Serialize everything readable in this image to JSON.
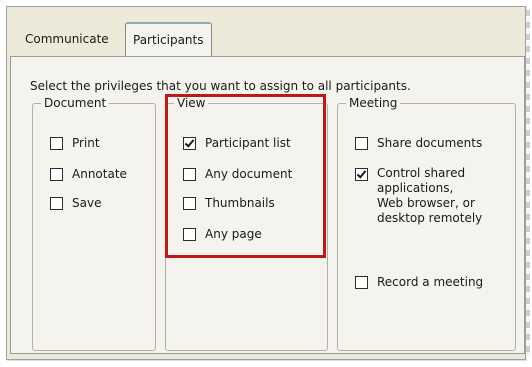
{
  "tabs": [
    {
      "label": "Communicate",
      "active": false
    },
    {
      "label": "Participants",
      "active": true
    }
  ],
  "instruction": "Select the privileges that you want to assign to all participants.",
  "groups": {
    "document": {
      "legend": "Document",
      "items": [
        {
          "label": "Print",
          "checked": false
        },
        {
          "label": "Annotate",
          "checked": false
        },
        {
          "label": "Save",
          "checked": false
        }
      ]
    },
    "view": {
      "legend": "View",
      "items": [
        {
          "label": "Participant list",
          "checked": true
        },
        {
          "label": "Any document",
          "checked": false
        },
        {
          "label": "Thumbnails",
          "checked": false
        },
        {
          "label": "Any page",
          "checked": false
        }
      ]
    },
    "meeting": {
      "legend": "Meeting",
      "items": [
        {
          "label": "Share documents",
          "checked": false
        },
        {
          "label": "Control shared\napplications,\nWeb browser, or\ndesktop remotely",
          "checked": true
        },
        {
          "label": "Record a meeting",
          "checked": false
        }
      ]
    }
  },
  "colors": {
    "highlight": "#c0171b",
    "dialog_bg": "#ece9d8"
  }
}
